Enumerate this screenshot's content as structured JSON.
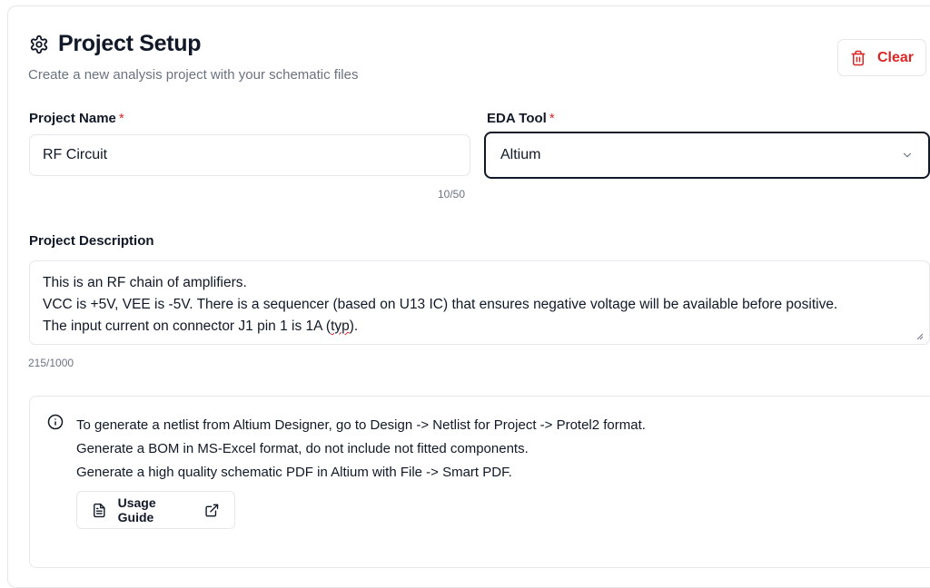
{
  "header": {
    "title": "Project Setup",
    "subtitle": "Create a new analysis project with your schematic files",
    "title_icon": "gear-icon",
    "clear_label": "Clear",
    "clear_icon": "trash-icon"
  },
  "form": {
    "project_name": {
      "label": "Project Name",
      "required_mark": "*",
      "value": "RF Circuit",
      "counter": "10/50"
    },
    "eda_tool": {
      "label": "EDA Tool",
      "required_mark": "*",
      "selected": "Altium",
      "icon": "chevron-down-icon"
    },
    "description": {
      "label": "Project Description",
      "lines": [
        "This is an RF chain of amplifiers.",
        "VCC is +5V, VEE is -5V. There is a sequencer (based on U13 IC) that ensures negative voltage will be available before positive.",
        "The input current on connector J1 pin 1 is 1A ("
      ],
      "misspelled_word": "typ",
      "line_end": ").",
      "counter": "215/1000"
    }
  },
  "info": {
    "icon": "info-icon",
    "lines": [
      "To generate a netlist from Altium Designer, go to Design -> Netlist for Project -> Protel2 format.",
      "Generate a BOM in MS-Excel format, do not include not fitted components.",
      "Generate a high quality schematic PDF in Altium with File -> Smart PDF."
    ],
    "guide_label": "Usage Guide",
    "guide_icon": "document-icon",
    "external_icon": "external-link-icon"
  },
  "colors": {
    "required": "#dc2626",
    "danger": "#dc2626",
    "muted_text": "#6b7280",
    "border": "#e5e7eb",
    "focus_border": "#111827"
  }
}
